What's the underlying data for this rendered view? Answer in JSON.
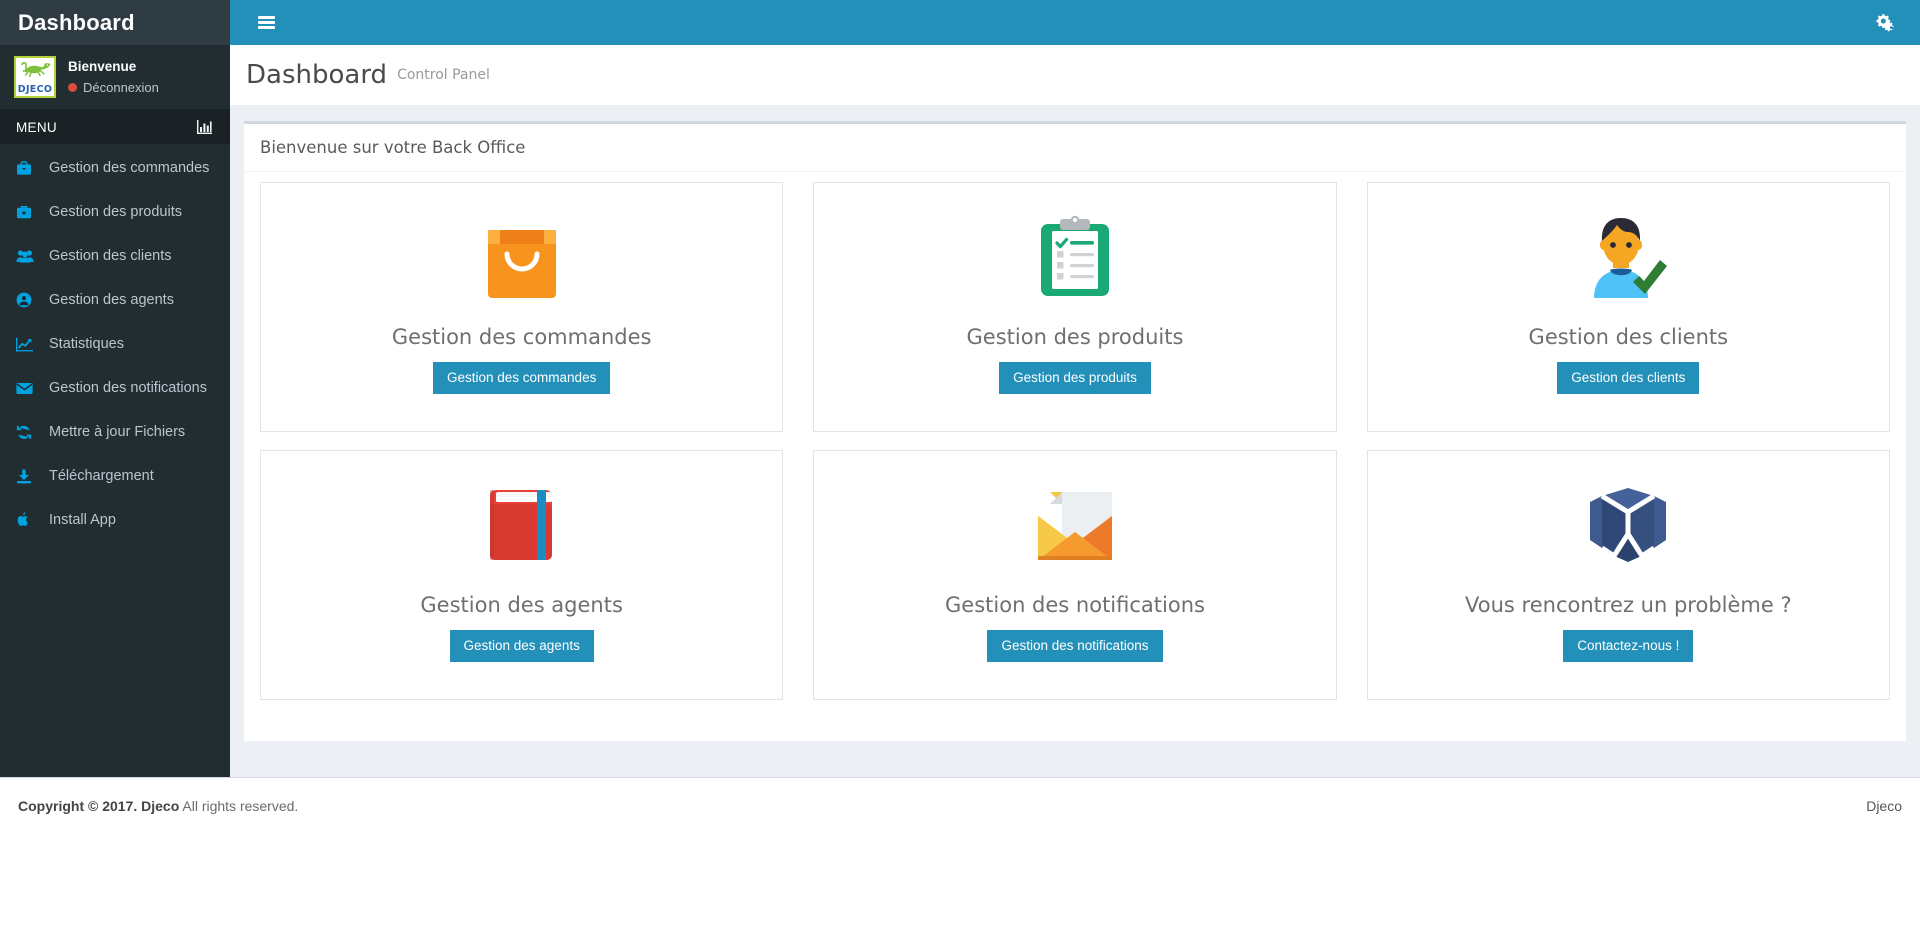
{
  "sidebar": {
    "brand": "Dashboard",
    "user": {
      "welcome": "Bienvenue",
      "logout": "Déconnexion",
      "logo_word": "DJECO",
      "logout_dot_color": "#dd4b39"
    },
    "menu_label": "MENU",
    "menu_header_icon": "bar-chart-icon",
    "items": [
      {
        "label": "Gestion des commandes",
        "icon": "briefcase-icon"
      },
      {
        "label": "Gestion des produits",
        "icon": "suitcase-icon"
      },
      {
        "label": "Gestion des clients",
        "icon": "users-icon"
      },
      {
        "label": "Gestion des agents",
        "icon": "user-circle-icon"
      },
      {
        "label": "Statistiques",
        "icon": "line-chart-icon"
      },
      {
        "label": "Gestion des notifications",
        "icon": "envelope-icon"
      },
      {
        "label": "Mettre à jour Fichiers",
        "icon": "refresh-icon"
      },
      {
        "label": "Téléchargement",
        "icon": "download-icon"
      },
      {
        "label": "Install App",
        "icon": "apple-icon"
      }
    ]
  },
  "topbar": {
    "toggle_icon": "hamburger-icon",
    "settings_icon": "cogs-icon",
    "background": "#2390ba"
  },
  "content_header": {
    "title": "Dashboard",
    "subtitle": "Control Panel"
  },
  "main": {
    "box_header": "Bienvenue sur votre Back Office",
    "cards": [
      {
        "title": "Gestion des commandes",
        "button": "Gestion des commandes",
        "icon": "shopping-bag-icon",
        "color": "#f7931e"
      },
      {
        "title": "Gestion des produits",
        "button": "Gestion des produits",
        "icon": "clipboard-checklist-icon",
        "color": "#19a974"
      },
      {
        "title": "Gestion des clients",
        "button": "Gestion des clients",
        "icon": "user-approved-icon",
        "color": "#f5a623"
      },
      {
        "title": "Gestion des agents",
        "button": "Gestion des agents",
        "icon": "address-book-icon",
        "color": "#d83a32"
      },
      {
        "title": "Gestion des notifications",
        "button": "Gestion des notifications",
        "icon": "open-envelope-icon",
        "color": "#f0a431"
      },
      {
        "title": "Vous rencontrez un problème ?",
        "button": "Contactez-nous !",
        "icon": "w-logo-icon",
        "color": "#3a5288"
      }
    ],
    "button_color": "#2390ba"
  },
  "footer": {
    "copyright_strong": "Copyright © 2017. Djeco",
    "copyright_rest": " All rights reserved.",
    "right": "Djeco"
  }
}
